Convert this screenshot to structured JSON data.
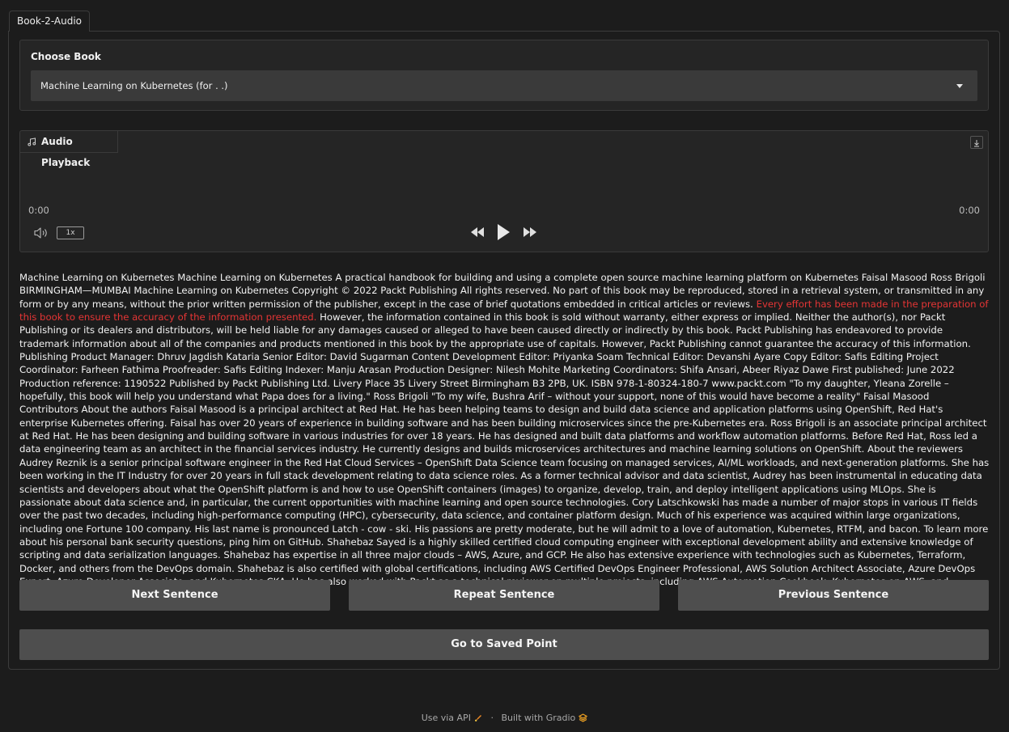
{
  "tab": {
    "label": "Book-2-Audio"
  },
  "choose_book": {
    "label": "Choose Book",
    "selected": "Machine Learning on Kubernetes (for . .)"
  },
  "audio": {
    "label": "Audio Playback",
    "time_start": "0:00",
    "time_end": "0:00",
    "speed": "1x"
  },
  "book_text": {
    "before": "Machine Learning on Kubernetes Machine Learning on Kubernetes A practical handbook for building and using a complete open source machine learning platform on Kubernetes Faisal Masood Ross Brigoli BIRMINGHAM—MUMBAI Machine Learning on Kubernetes Copyright © 2022 Packt Publishing All rights reserved. No part of this book may be reproduced, stored in a retrieval system, or transmitted in any form or by any means, without the prior written permission of the publisher, except in the case of brief quotations embedded in critical articles or reviews. ",
    "highlight": "Every effort has been made in the preparation of this book to ensure the accuracy of the information presented.",
    "after": " However, the information contained in this book is sold without warranty, either express or implied. Neither the author(s), nor Packt Publishing or its dealers and distributors, will be held liable for any damages caused or alleged to have been caused directly or indirectly by this book. Packt Publishing has endeavored to provide trademark information about all of the companies and products mentioned in this book by the appropriate use of capitals. However, Packt Publishing cannot guarantee the accuracy of this information. Publishing Product Manager: Dhruv Jagdish Kataria Senior Editor: David Sugarman Content Development Editor: Priyanka Soam Technical Editor: Devanshi Ayare Copy Editor: Safis Editing Project Coordinator: Farheen Fathima Proofreader: Safis Editing Indexer: Manju Arasan Production Designer: Nilesh Mohite Marketing Coordinators: Shifa Ansari, Abeer Riyaz Dawe First published: June 2022 Production reference: 1190522 Published by Packt Publishing Ltd. Livery Place 35 Livery Street Birmingham B3 2PB, UK. ISBN 978-1-80324-180-7 www.packt.com \"To my daughter, Yleana Zorelle – hopefully, this book will help you understand what Papa does for a living.\" Ross Brigoli \"To my wife, Bushra Arif – without your support, none of this would have become a reality\" Faisal Masood Contributors About the authors Faisal Masood is a principal architect at Red Hat. He has been helping teams to design and build data science and application platforms using OpenShift, Red Hat's enterprise Kubernetes offering. Faisal has over 20 years of experience in building software and has been building microservices since the pre-Kubernetes era. Ross Brigoli is an associate principal architect at Red Hat. He has been designing and building software in various industries for over 18 years. He has designed and built data platforms and workflow automation platforms. Before Red Hat, Ross led a data engineering team as an architect in the financial services industry. He currently designs and builds microservices architectures and machine learning solutions on OpenShift. About the reviewers Audrey Reznik is a senior principal software engineer in the Red Hat Cloud Services – OpenShift Data Science team focusing on managed services, AI/ML workloads, and next-generation platforms. She has been working in the IT Industry for over 20 years in full stack development relating to data science roles. As a former technical advisor and data scientist, Audrey has been instrumental in educating data scientists and developers about what the OpenShift platform is and how to use OpenShift containers (images) to organize, develop, train, and deploy intelligent applications using MLOps. She is passionate about data science and, in particular, the current opportunities with machine learning and open source technologies. Cory Latschkowski has made a number of major stops in various IT fields over the past two decades, including high-performance computing (HPC), cybersecurity, data science, and container platform design. Much of his experience was acquired within large organizations, including one Fortune 100 company. His last name is pronounced Latch - cow - ski. His passions are pretty moderate, but he will admit to a love of automation, Kubernetes, RTFM, and bacon. To learn more about his personal bank security questions, ping him on GitHub. Shahebaz Sayed is a highly skilled certified cloud computing engineer with exceptional development ability and extensive knowledge of scripting and data serialization languages. Shahebaz has expertise in all three major clouds – AWS, Azure, and GCP. He also has extensive experience with technologies such as Kubernetes, Terraform, Docker, and others from the DevOps domain. Shahebaz is also certified with global certifications, including AWS Certified DevOps Engineer Professional, AWS Solution Architect Associate, Azure DevOps Expert, Azure Developer Associate, and Kubernetes CKA. He has also worked with Packt as a technical reviewer on multiple projects, including AWS Automation Cookbook, Kubernetes on AWS, and Kubernetes for Serverless Applications."
  },
  "buttons": {
    "next": "Next Sentence",
    "repeat": "Repeat Sentence",
    "previous": "Previous Sentence",
    "saved": "Go to Saved Point"
  },
  "footer": {
    "api": "Use via API",
    "separator": "·",
    "built": "Built with Gradio"
  },
  "colors": {
    "background": "#1c1c1c",
    "highlight": "#e53535",
    "button": "#4e4e4e",
    "api_icon": "#f08a24",
    "gradio_icon": "#f5a623"
  }
}
